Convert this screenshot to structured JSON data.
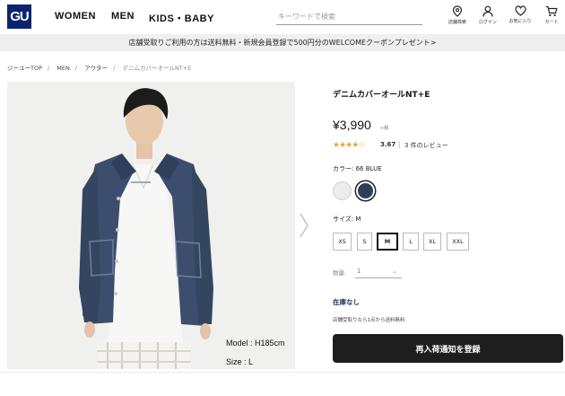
{
  "header": {
    "logo": "GU",
    "nav": [
      "WOMEN",
      "MEN",
      "KIDS・BABY"
    ],
    "search_placeholder": "キーワードで検索",
    "icons": [
      {
        "name": "store-locator-icon",
        "label": "店舗検索"
      },
      {
        "name": "login-icon",
        "label": "ログイン"
      },
      {
        "name": "favorites-icon",
        "label": "お気に入り"
      },
      {
        "name": "cart-icon",
        "label": "カート"
      }
    ]
  },
  "banner": {
    "text": "店舗受取りご利用の方は送料無料・新規会員登録で500円分のWELCOMEクーポンプレゼント>"
  },
  "breadcrumb": [
    "ジーユーTOP",
    "MEN",
    "アウター",
    "デニムカバーオールNT+E"
  ],
  "product": {
    "name": "デニムカバーオールNT+E",
    "price": "¥3,990",
    "tax_note": "+税",
    "stars": "★★★★☆",
    "rating": "3.67",
    "review_count": "3 件のレビュー",
    "color_label": "カラー: 66 BLUE",
    "colors": [
      {
        "name": "white",
        "hex": "#ececea"
      },
      {
        "name": "blue",
        "hex": "#2d3e5c",
        "selected": true
      }
    ],
    "size_label": "サイズ: M",
    "sizes": [
      "XS",
      "S",
      "M",
      "L",
      "XL",
      "XXL"
    ],
    "selected_size": "M",
    "quantity_label": "数量:",
    "quantity_value": "1",
    "stock_status": "在庫なし",
    "shipping_note": "店舗受取りなら1点から送料無料",
    "restock_button": "再入荷通知を登録",
    "model_height": "Model : H185cm",
    "model_size": "Size : L"
  }
}
